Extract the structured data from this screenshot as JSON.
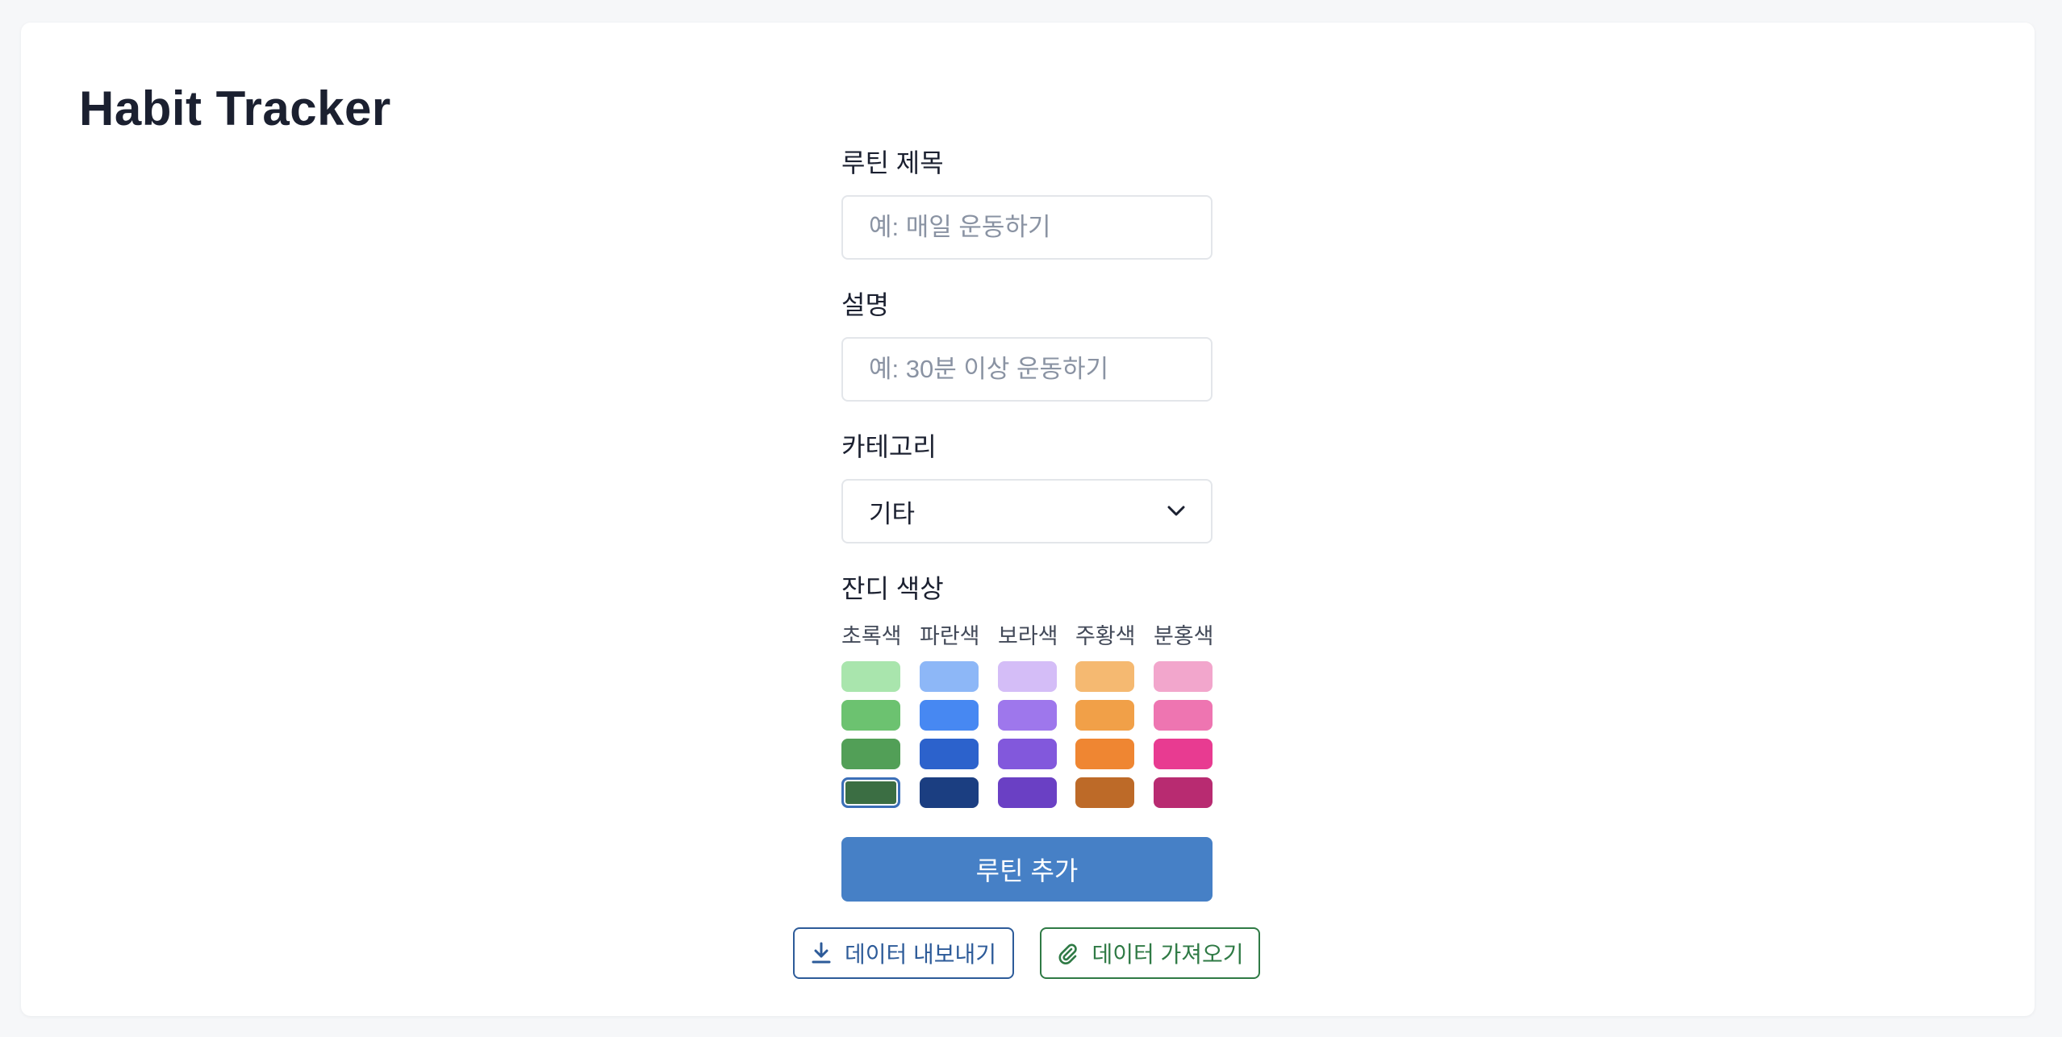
{
  "app": {
    "title": "Habit Tracker"
  },
  "form": {
    "title_label": "루틴 제목",
    "title_placeholder": "예: 매일 운동하기",
    "title_value": "",
    "description_label": "설명",
    "description_placeholder": "예: 30분 이상 운동하기",
    "description_value": "",
    "category_label": "카테고리",
    "category_selected": "기타",
    "color_label": "잔디 색상",
    "submit_label": "루틴 추가"
  },
  "palette": {
    "columns": [
      {
        "name": "초록색",
        "shades": [
          "#a9e5ad",
          "#6cc270",
          "#529f57",
          "#3b6e43"
        ]
      },
      {
        "name": "파란색",
        "shades": [
          "#8db7f7",
          "#4788f2",
          "#2c62cc",
          "#1b3e81"
        ]
      },
      {
        "name": "보라색",
        "shades": [
          "#d4bdf7",
          "#9e77ec",
          "#8258dc",
          "#6a40c4"
        ]
      },
      {
        "name": "주황색",
        "shades": [
          "#f5b971",
          "#f1a048",
          "#ef8632",
          "#bd6a28"
        ]
      },
      {
        "name": "분홍색",
        "shades": [
          "#f2a6cc",
          "#ee75b1",
          "#e83b91",
          "#b82b71"
        ]
      }
    ],
    "selected": {
      "column": 0,
      "shade": 3
    }
  },
  "actions": {
    "export_label": "데이터 내보내기",
    "import_label": "데이터 가져오기",
    "export_icon": "download-icon",
    "import_icon": "paperclip-icon"
  }
}
